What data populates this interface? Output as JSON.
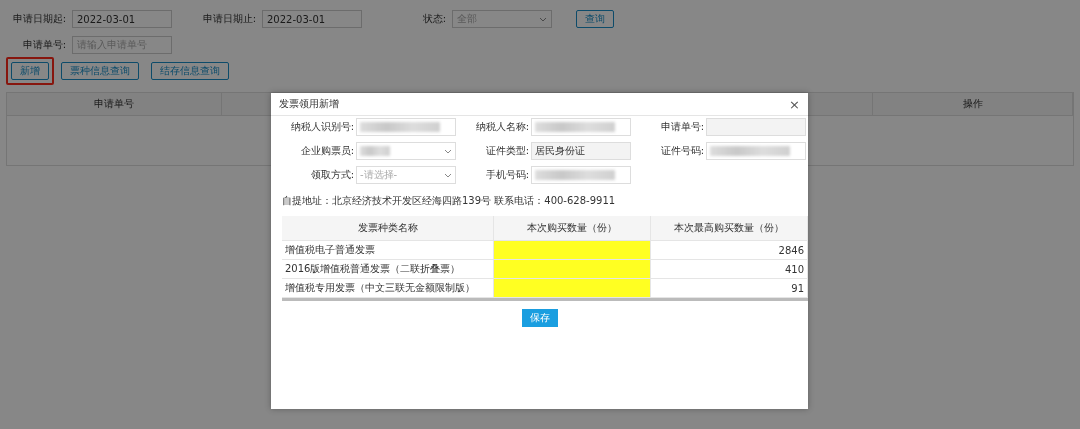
{
  "filters": [
    {
      "label": "申请日期起:",
      "kind": "input",
      "value": "2022-03-01"
    },
    {
      "label": "申请日期止:",
      "kind": "input",
      "value": "2022-03-01"
    },
    {
      "label": "状态:",
      "kind": "select",
      "placeholder": "全部"
    }
  ],
  "search_button": "查询",
  "filters_row2": [
    {
      "label": "申请单号:",
      "kind": "input",
      "placeholder": "请输入申请单号"
    }
  ],
  "actions": [
    {
      "label": "新增",
      "highlighted": true
    },
    {
      "label": "票种信息查询",
      "highlighted": false
    },
    {
      "label": "结存信息查询",
      "highlighted": false
    }
  ],
  "table": {
    "columns": [
      {
        "label": "申请单号"
      },
      {},
      {
        "label": "操作"
      }
    ]
  },
  "dialog": {
    "title": "发票领用新增",
    "close": "×",
    "fields": [
      {
        "label": "纳税人识别号:",
        "kind": "redacted"
      },
      {
        "label": "纳税人名称:",
        "kind": "redacted"
      },
      {
        "label": "申请单号:",
        "kind": "readonly"
      },
      {
        "label": "企业购票员:",
        "kind": "redacted-select"
      },
      {
        "label": "证件类型:",
        "kind": "readonly",
        "value": "居民身份证"
      },
      {
        "label": "证件号码:",
        "kind": "redacted"
      },
      {
        "label": "领取方式:",
        "kind": "select",
        "placeholder": "-请选择-"
      },
      {
        "label": "手机号码:",
        "kind": "redacted"
      }
    ],
    "note": "自提地址：北京经济技术开发区经海四路139号 联系电话：400-628-9911",
    "table": {
      "columns": [
        "发票种类名称",
        "本次购买数量（份）",
        "本次最高购买数量（份）"
      ],
      "rows": [
        {
          "name": "增值税电子普通发票",
          "max": "2846",
          "color": "#ffff22"
        },
        {
          "name": "2016版增值税普通发票（二联折叠票）",
          "max": "410",
          "color": "#ffff22"
        },
        {
          "name": "增值税专用发票（中文三联无金额限制版）",
          "max": "91",
          "color": "#ffff22"
        }
      ]
    },
    "save_button": "保存"
  }
}
